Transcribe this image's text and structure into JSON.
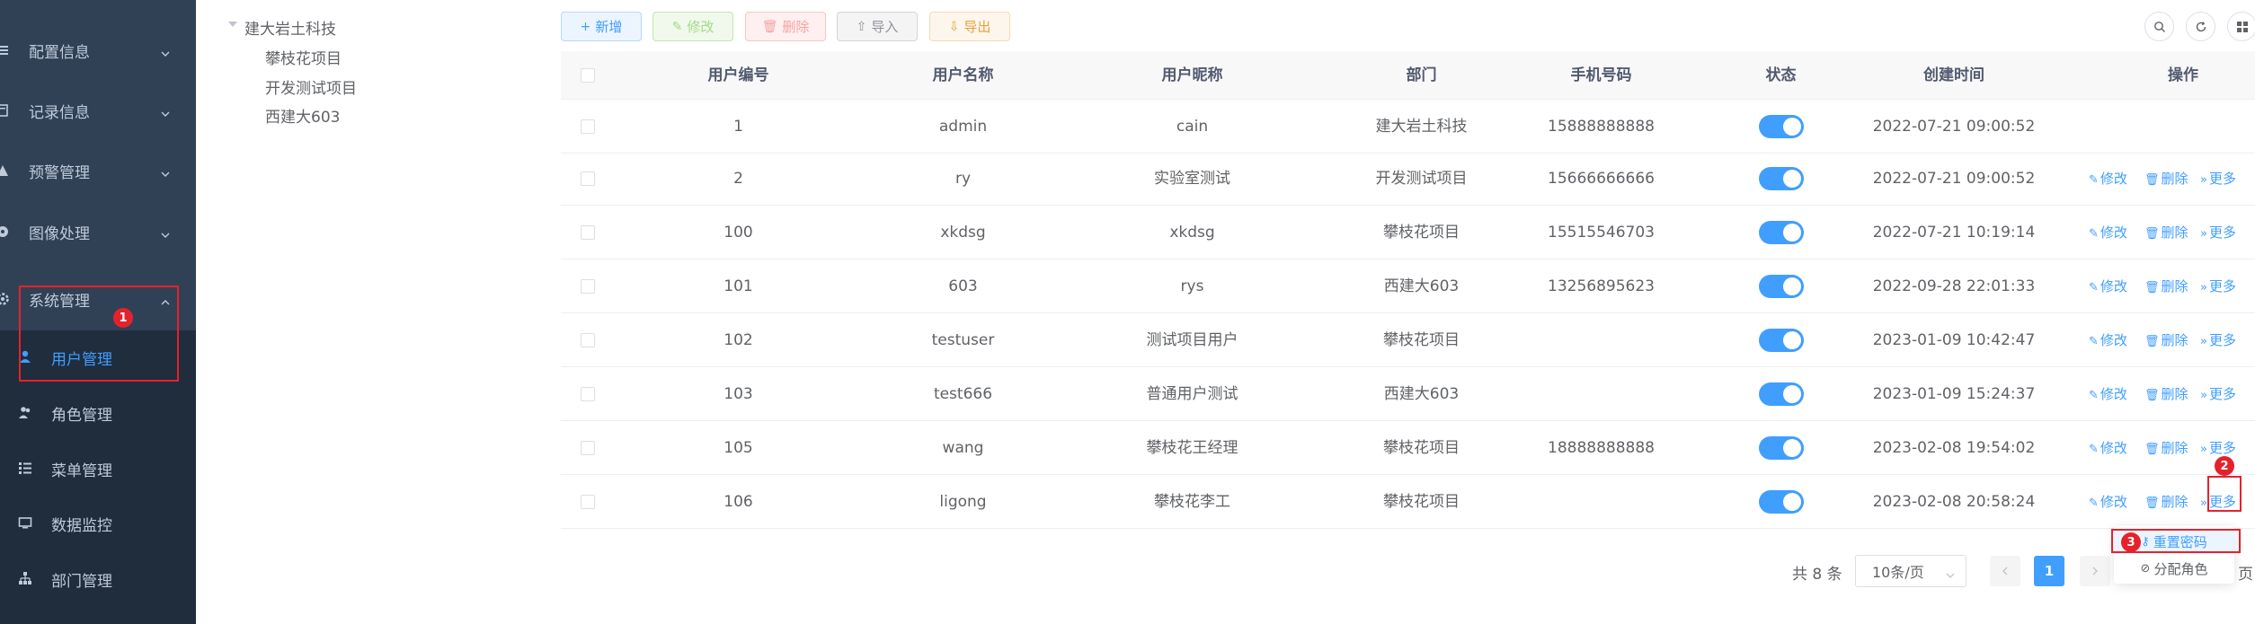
{
  "sidebar": {
    "items": [
      {
        "label": "配置信息",
        "icon": "settings-icon"
      },
      {
        "label": "记录信息",
        "icon": "record-icon"
      },
      {
        "label": "预警管理",
        "icon": "warning-icon"
      },
      {
        "label": "图像处理",
        "icon": "image-icon"
      },
      {
        "label": "系统管理",
        "icon": "gear-icon"
      }
    ],
    "children": [
      {
        "label": "用户管理",
        "icon": "user-icon",
        "active": true
      },
      {
        "label": "角色管理",
        "icon": "role-icon"
      },
      {
        "label": "菜单管理",
        "icon": "menu-list-icon"
      },
      {
        "label": "数据监控",
        "icon": "monitor-icon"
      },
      {
        "label": "部门管理",
        "icon": "org-tree-icon"
      }
    ]
  },
  "tree": {
    "root": "建大岩土科技",
    "children": [
      "攀枝花项目",
      "开发测试项目",
      "西建大603"
    ]
  },
  "toolbar": {
    "add": "新增",
    "edit": "修改",
    "delete": "删除",
    "import": "导入",
    "export": "导出"
  },
  "table": {
    "headers": [
      "用户编号",
      "用户名称",
      "用户昵称",
      "部门",
      "手机号码",
      "状态",
      "创建时间",
      "操作"
    ],
    "rows": [
      {
        "id": "1",
        "name": "admin",
        "nick": "cain",
        "dept": "建大岩土科技",
        "phone": "15888888888",
        "status": true,
        "time": "2022-07-21 09:00:52",
        "ops": false
      },
      {
        "id": "2",
        "name": "ry",
        "nick": "实验室测试",
        "dept": "开发测试项目",
        "phone": "15666666666",
        "status": true,
        "time": "2022-07-21 09:00:52",
        "ops": true
      },
      {
        "id": "100",
        "name": "xkdsg",
        "nick": "xkdsg",
        "dept": "攀枝花项目",
        "phone": "15515546703",
        "status": true,
        "time": "2022-07-21 10:19:14",
        "ops": true
      },
      {
        "id": "101",
        "name": "603",
        "nick": "rys",
        "dept": "西建大603",
        "phone": "13256895623",
        "status": true,
        "time": "2022-09-28 22:01:33",
        "ops": true
      },
      {
        "id": "102",
        "name": "testuser",
        "nick": "测试项目用户",
        "dept": "攀枝花项目",
        "phone": "",
        "status": true,
        "time": "2023-01-09 10:42:47",
        "ops": true
      },
      {
        "id": "103",
        "name": "test666",
        "nick": "普通用户测试",
        "dept": "西建大603",
        "phone": "",
        "status": true,
        "time": "2023-01-09 15:24:37",
        "ops": true
      },
      {
        "id": "105",
        "name": "wang",
        "nick": "攀枝花王经理",
        "dept": "攀枝花项目",
        "phone": "18888888888",
        "status": true,
        "time": "2023-02-08 19:54:02",
        "ops": true
      },
      {
        "id": "106",
        "name": "ligong",
        "nick": "攀枝花李工",
        "dept": "攀枝花项目",
        "phone": "",
        "status": true,
        "time": "2023-02-08 20:58:24",
        "ops": true
      }
    ],
    "op_edit": "修改",
    "op_delete": "删除",
    "op_more": "更多"
  },
  "pagination": {
    "total": "共 8 条",
    "page_size": "10条/页",
    "current": "1",
    "tail": "页"
  },
  "dropdown": {
    "reset_password": "重置密码",
    "assign_role": "分配角色"
  },
  "annotations": [
    "1",
    "2",
    "3"
  ],
  "colors": {
    "accent": "#409eff",
    "sidebar": "#304156",
    "annotation": "#e5222c"
  }
}
